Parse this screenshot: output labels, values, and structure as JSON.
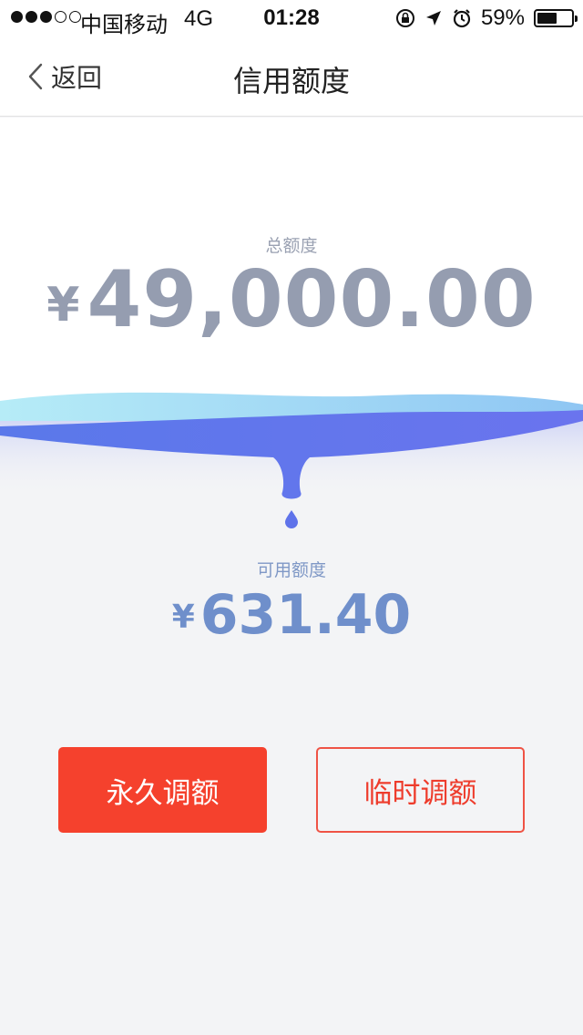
{
  "status_bar": {
    "signal_total": 5,
    "signal_active": 3,
    "carrier": "中国移动",
    "network": "4G",
    "time": "01:28",
    "battery_percent": "59%",
    "battery_level": 0.59,
    "icons": [
      "rotation-lock-icon",
      "location-arrow-icon",
      "alarm-icon",
      "battery-icon"
    ]
  },
  "nav": {
    "back_label": "返回",
    "title": "信用额度"
  },
  "total": {
    "label": "总额度",
    "currency": "¥",
    "amount": "49,000.00"
  },
  "available": {
    "label": "可用额度",
    "currency": "¥",
    "amount": "631.40"
  },
  "actions": {
    "permanent_label": "永久调额",
    "temporary_label": "临时调额"
  },
  "colors": {
    "primary": "#f5412d",
    "wave_dark": "#5a72ea",
    "wave_light": "#9fd8f4",
    "amount_gray": "#959db0",
    "amount_blue": "#6f8fcb"
  }
}
